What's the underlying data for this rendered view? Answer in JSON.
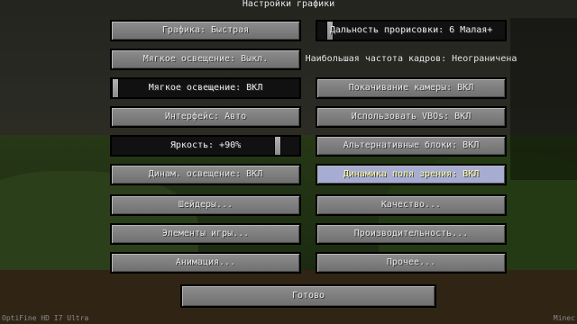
{
  "screen": {
    "title": "Настройки графики",
    "left_column": [
      "Графика: Быстрая",
      "Мягкое освещение: Выкл.",
      "Мягкое освещение: ВКЛ",
      "Интерфейс: Авто",
      "Яркость: +90%",
      "Динам. освещение: ВКЛ",
      "Шейдеры...",
      "Элементы игры...",
      "Анимация..."
    ],
    "right_column": [
      "Дальность прорисовки: 6 Малая+",
      "Наибольшая частота кадров: Неограничена",
      "Покачивание камеры: ВКЛ",
      "Использовать VBOs: ВКЛ",
      "Альтернативные блоки: ВКЛ",
      "Динамика поля зрения: ВКЛ",
      "Качество...",
      "Производительность...",
      "Прочее..."
    ],
    "done_button": "Готово",
    "footer_left": "OptiFine HD I7 Ultra",
    "footer_right": "Minec"
  },
  "values": {
    "render_distance_level": 0.05,
    "max_fps_level": 1.0,
    "smooth_lighting_level": 0.0,
    "brightness_level": 0.9
  },
  "highlight_color": "#a7acd2"
}
